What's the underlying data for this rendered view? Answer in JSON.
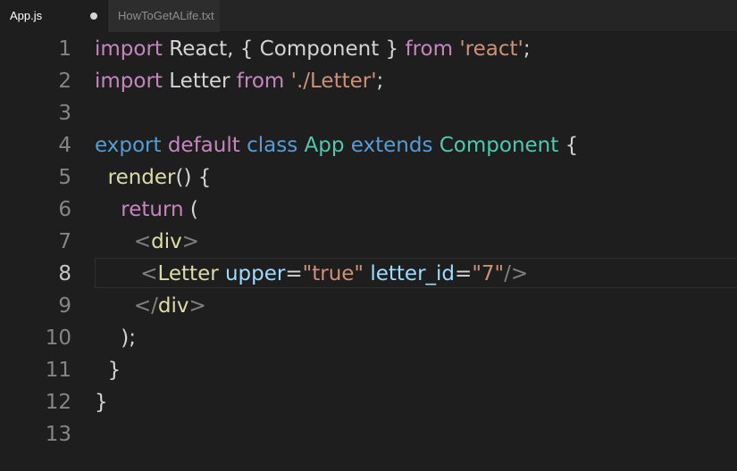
{
  "tabs": [
    {
      "label": "App.js",
      "active": true,
      "modified": true
    },
    {
      "label": "HowToGetALife.txt",
      "active": false
    }
  ],
  "colors": {
    "background": "#1e1e1e",
    "keyword": "#c586c0",
    "string": "#ce9178",
    "storage": "#569cd6",
    "class_name": "#4ec9b0",
    "function": "#dcdcaa",
    "attribute": "#9cdcfe",
    "punctuation": "#808080",
    "text": "#d4d4d4"
  },
  "editor": {
    "current_line": 8,
    "lines": [
      {
        "number": "1",
        "tokens": [
          {
            "t": "import",
            "c": "kw"
          },
          {
            "t": " React, { Component } ",
            "c": "tx"
          },
          {
            "t": "from",
            "c": "kw"
          },
          {
            "t": " ",
            "c": "tx"
          },
          {
            "t": "'react'",
            "c": "st"
          },
          {
            "t": ";",
            "c": "tx"
          }
        ]
      },
      {
        "number": "2",
        "tokens": [
          {
            "t": "import",
            "c": "kw"
          },
          {
            "t": " Letter ",
            "c": "tx"
          },
          {
            "t": "from",
            "c": "kw"
          },
          {
            "t": " ",
            "c": "tx"
          },
          {
            "t": "'./Letter'",
            "c": "st"
          },
          {
            "t": ";",
            "c": "tx"
          }
        ]
      },
      {
        "number": "3",
        "tokens": []
      },
      {
        "number": "4",
        "tokens": [
          {
            "t": "export",
            "c": "bl"
          },
          {
            "t": " ",
            "c": "tx"
          },
          {
            "t": "default",
            "c": "kw"
          },
          {
            "t": " ",
            "c": "tx"
          },
          {
            "t": "class",
            "c": "bl"
          },
          {
            "t": " ",
            "c": "tx"
          },
          {
            "t": "App",
            "c": "cls"
          },
          {
            "t": " ",
            "c": "tx"
          },
          {
            "t": "extends",
            "c": "bl"
          },
          {
            "t": " ",
            "c": "tx"
          },
          {
            "t": "Component",
            "c": "cls"
          },
          {
            "t": " {",
            "c": "tx"
          }
        ]
      },
      {
        "number": "5",
        "tokens": [
          {
            "t": "  ",
            "c": "tx"
          },
          {
            "t": "render",
            "c": "fn"
          },
          {
            "t": "() {",
            "c": "tx"
          }
        ]
      },
      {
        "number": "6",
        "tokens": [
          {
            "t": "    ",
            "c": "tx"
          },
          {
            "t": "return",
            "c": "kw"
          },
          {
            "t": " (",
            "c": "tx"
          }
        ]
      },
      {
        "number": "7",
        "tokens": [
          {
            "t": "      ",
            "c": "tx"
          },
          {
            "t": "<",
            "c": "pn"
          },
          {
            "t": "div",
            "c": "fn"
          },
          {
            "t": ">",
            "c": "pn"
          }
        ]
      },
      {
        "number": "8",
        "tokens": [
          {
            "t": "       ",
            "c": "tx"
          },
          {
            "t": "<",
            "c": "pn"
          },
          {
            "t": "Letter",
            "c": "fn"
          },
          {
            "t": " ",
            "c": "tx"
          },
          {
            "t": "upper",
            "c": "at"
          },
          {
            "t": "=",
            "c": "tx"
          },
          {
            "t": "\"true\"",
            "c": "st"
          },
          {
            "t": " ",
            "c": "tx"
          },
          {
            "t": "letter_id",
            "c": "at"
          },
          {
            "t": "=",
            "c": "tx"
          },
          {
            "t": "\"7\"",
            "c": "st"
          },
          {
            "t": "/>",
            "c": "pn"
          }
        ]
      },
      {
        "number": "9",
        "tokens": [
          {
            "t": "      ",
            "c": "tx"
          },
          {
            "t": "</",
            "c": "pn"
          },
          {
            "t": "div",
            "c": "fn"
          },
          {
            "t": ">",
            "c": "pn"
          }
        ]
      },
      {
        "number": "10",
        "tokens": [
          {
            "t": "    ",
            "c": "tx"
          },
          {
            "t": ");",
            "c": "tx"
          }
        ]
      },
      {
        "number": "11",
        "tokens": [
          {
            "t": "  ",
            "c": "tx"
          },
          {
            "t": "}",
            "c": "tx"
          }
        ]
      },
      {
        "number": "12",
        "tokens": [
          {
            "t": "}",
            "c": "tx"
          }
        ]
      },
      {
        "number": "13",
        "tokens": []
      }
    ]
  }
}
